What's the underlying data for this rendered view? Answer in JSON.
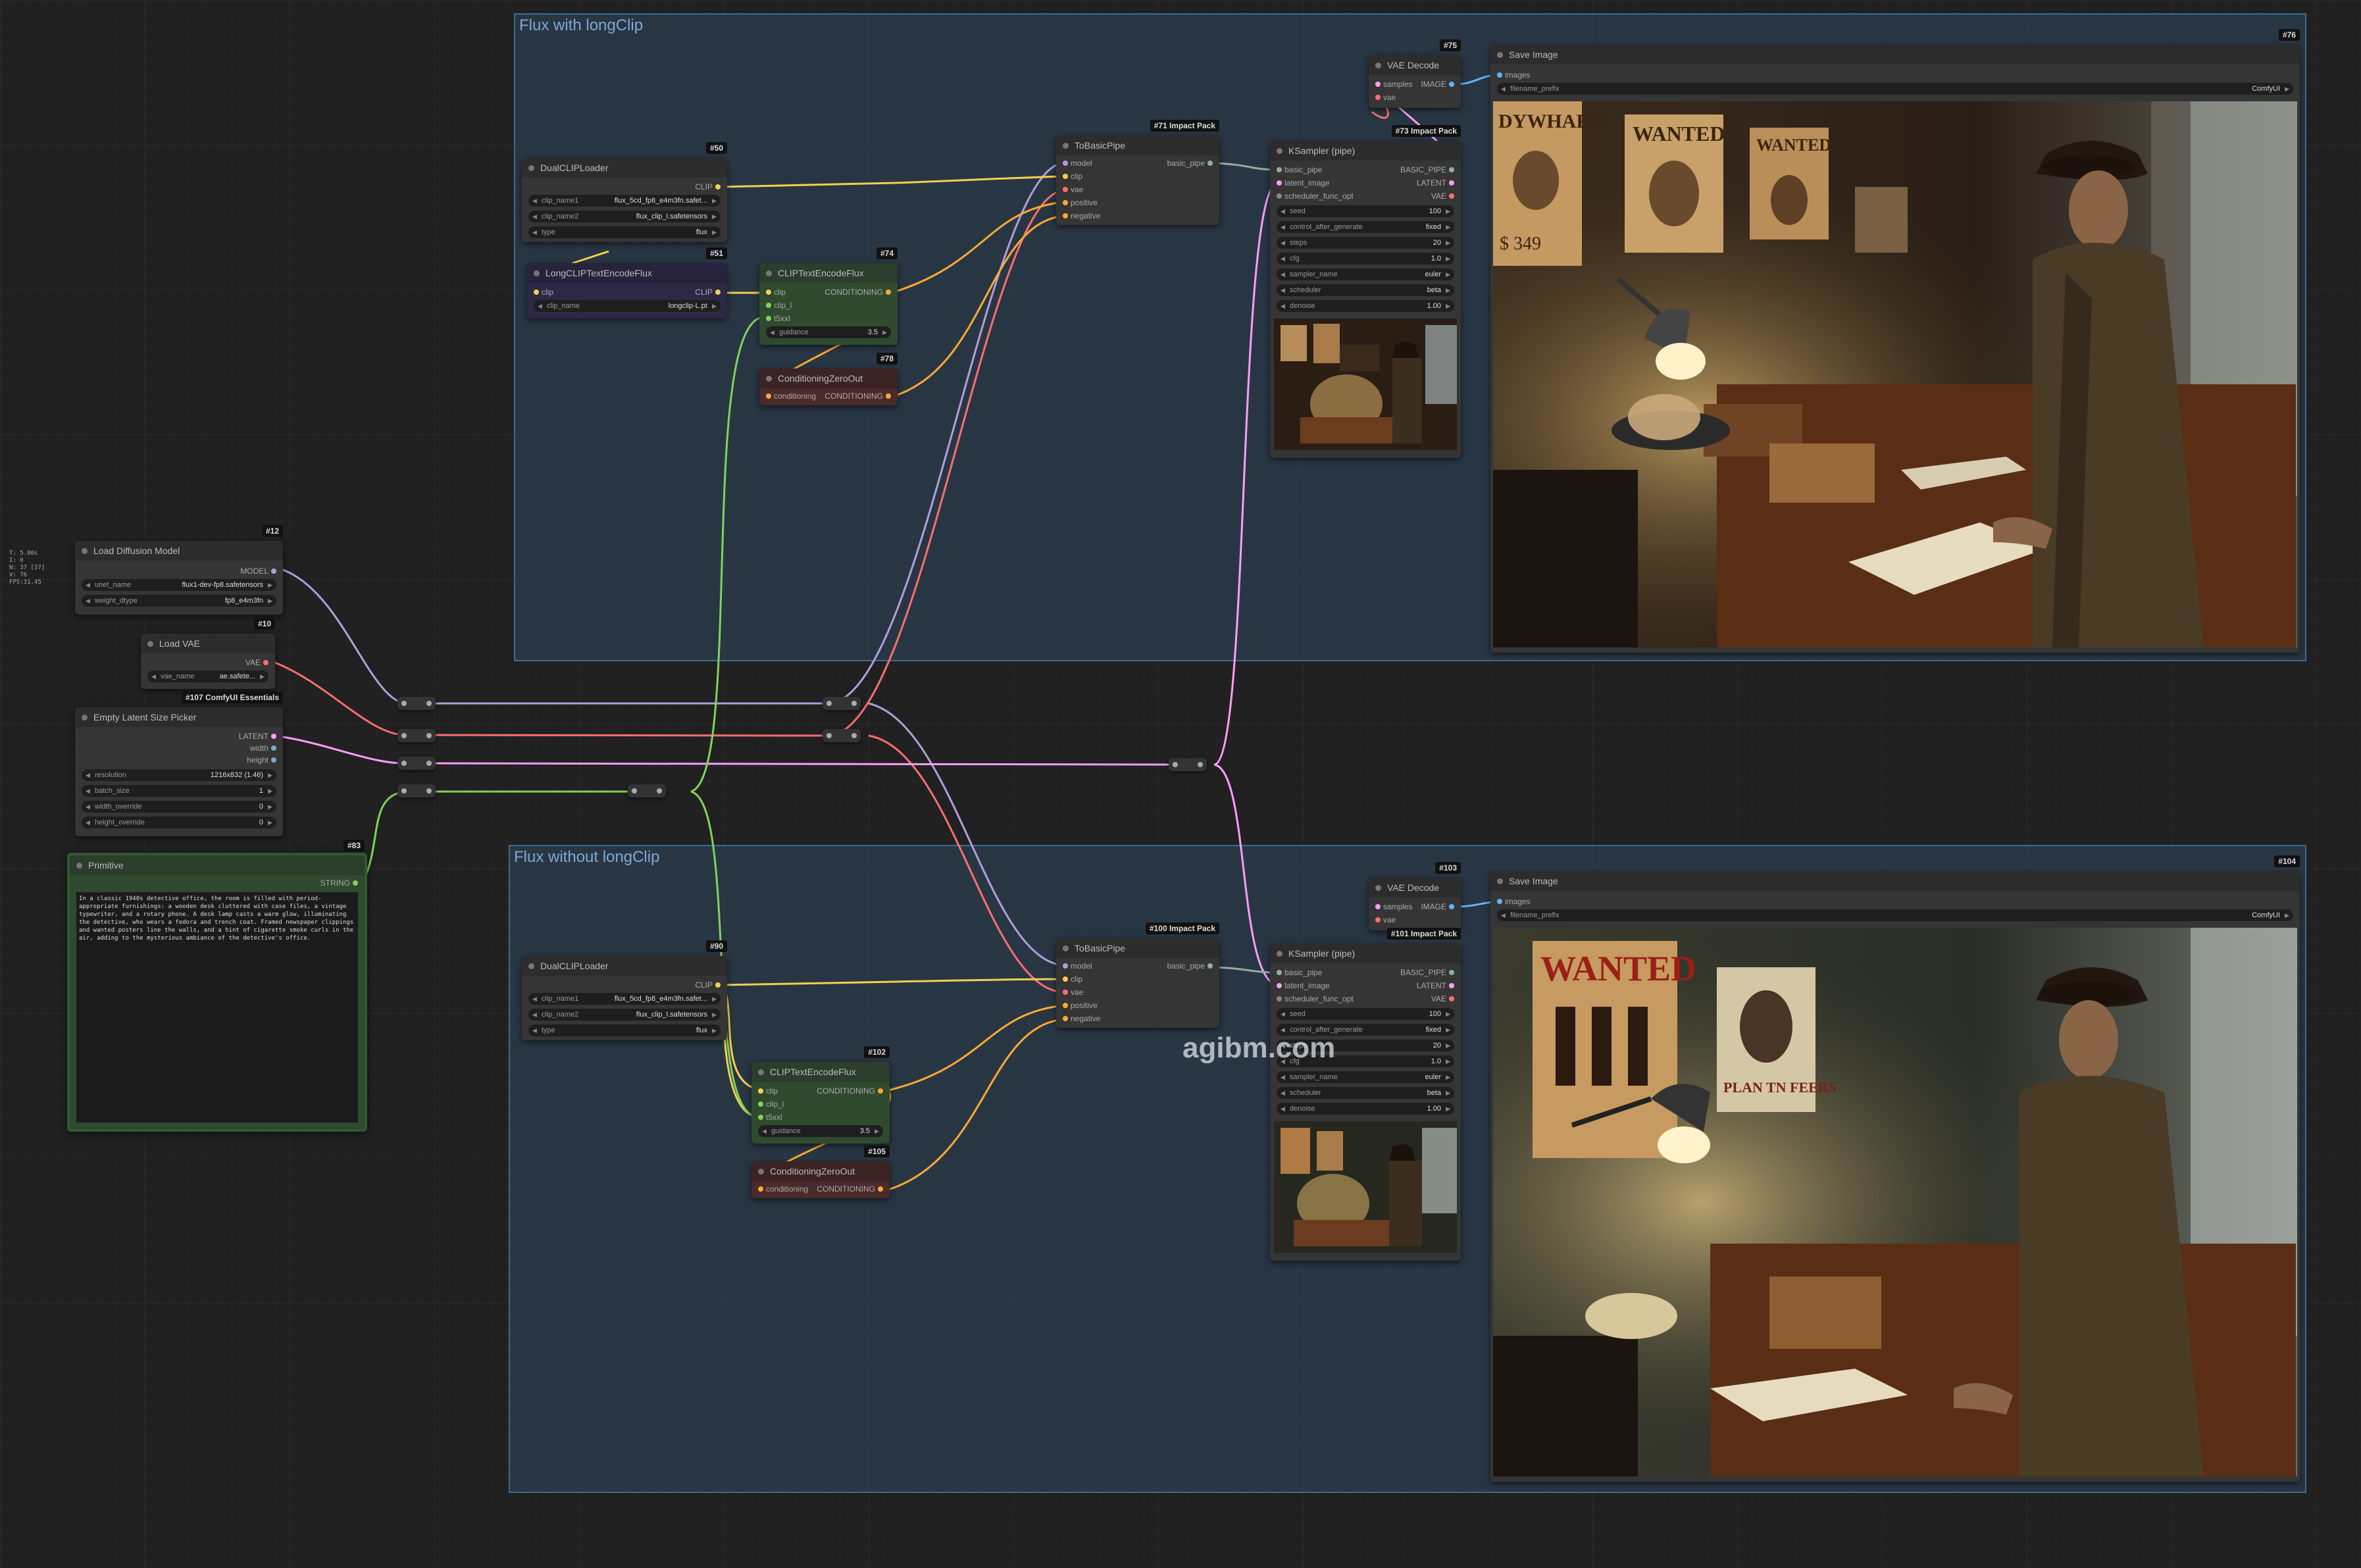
{
  "stats": [
    "T: 5.00s",
    "I: 0",
    "N: 37 [37]",
    "V: 76",
    "FPS:31.45"
  ],
  "groups": {
    "top": "Flux with longClip",
    "bottom": "Flux without longClip"
  },
  "watermark": "agibm.com",
  "colors": {
    "model": "#b39ddb",
    "clip": "#f6d04d",
    "vae": "#ff6e6e",
    "latent": "#ff9cf9",
    "cond": "#ffa931",
    "image": "#64b5f6",
    "string": "#7fd35c"
  },
  "nodes": {
    "load_diffusion": {
      "id": "#12",
      "title": "Load Diffusion Model",
      "out": "MODEL",
      "w": [
        [
          "unet_name",
          "flux1-dev-fp8.safetensors"
        ],
        [
          "weight_dtype",
          "fp8_e4m3fn"
        ]
      ]
    },
    "load_vae": {
      "id": "#10",
      "title": "Load VAE",
      "out": "VAE",
      "w": [
        [
          "vae_name",
          "ae.safete..."
        ]
      ]
    },
    "empty_latent": {
      "id": "#107 ComfyUI Essentials",
      "title": "Empty Latent Size Picker",
      "outs": [
        "LATENT",
        "width",
        "height"
      ],
      "w": [
        [
          "resolution",
          "1216x832 (1.46)"
        ],
        [
          "batch_size",
          "1"
        ],
        [
          "width_override",
          "0"
        ],
        [
          "height_override",
          "0"
        ]
      ]
    },
    "primitive": {
      "id": "#83",
      "title": "Primitive",
      "out": "STRING",
      "text": "In a classic 1940s detective office, the room is filled with period-appropriate furnishings: a wooden desk cluttered with case files, a vintage typewriter, and a rotary phone. A desk lamp casts a warm glow, illuminating the detective, who wears a fedora and trench coat. Framed newspaper clippings and wanted posters line the walls, and a hint of cigarette smoke curls in the air, adding to the mysterious ambiance of the detective's office."
    },
    "dualclip_top": {
      "id": "#50",
      "title": "DualCLIPLoader",
      "out": "CLIP",
      "w": [
        [
          "clip_name1",
          "flux_5cd_fp8_e4m3fn.safet..."
        ],
        [
          "clip_name2",
          "flux_clip_l.safetensors"
        ],
        [
          "type",
          "flux"
        ]
      ]
    },
    "longclip": {
      "id": "#51",
      "title": "LongCLIPTextEncodeFlux",
      "in": "clip",
      "out": "CLIP",
      "w": [
        [
          "clip_name",
          "longclip-L.pt"
        ]
      ]
    },
    "clipenc_top": {
      "id": "#74",
      "title": "CLIPTextEncodeFlux",
      "ins": [
        "clip",
        "clip_l",
        "t5xxl"
      ],
      "out": "CONDITIONING",
      "w": [
        [
          "guidance",
          "3.5"
        ]
      ]
    },
    "zero_top": {
      "id": "#78",
      "title": "ConditioningZeroOut",
      "in": "conditioning",
      "out": "CONDITIONING"
    },
    "tobasic_top": {
      "id": "#71 Impact Pack",
      "title": "ToBasicPipe",
      "ins": [
        "model",
        "clip",
        "vae",
        "positive",
        "negative"
      ],
      "out": "basic_pipe"
    },
    "vaedec_top": {
      "id": "#75",
      "title": "VAE Decode",
      "ins": [
        "samples",
        "vae"
      ],
      "out": "IMAGE"
    },
    "ksampler_top": {
      "id": "#73 Impact Pack",
      "title": "KSampler (pipe)",
      "ins": [
        "basic_pipe",
        "latent_image",
        "scheduler_func_opt"
      ],
      "outs": [
        "BASIC_PIPE",
        "LATENT",
        "VAE"
      ],
      "w": [
        [
          "seed",
          "100"
        ],
        [
          "control_after_generate",
          "fixed"
        ],
        [
          "steps",
          "20"
        ],
        [
          "cfg",
          "1.0"
        ],
        [
          "sampler_name",
          "euler"
        ],
        [
          "scheduler",
          "beta"
        ],
        [
          "denoise",
          "1.00"
        ]
      ]
    },
    "save_top": {
      "id": "#76",
      "title": "Save Image",
      "in": "images",
      "w": [
        [
          "filename_prefix",
          "ComfyUI"
        ]
      ]
    },
    "dualclip_bot": {
      "id": "#90",
      "title": "DualCLIPLoader",
      "out": "CLIP",
      "w": [
        [
          "clip_name1",
          "flux_5cd_fp8_e4m3fn.safet..."
        ],
        [
          "clip_name2",
          "flux_clip_l.safetensors"
        ],
        [
          "type",
          "flux"
        ]
      ]
    },
    "clipenc_bot": {
      "id": "#102",
      "title": "CLIPTextEncodeFlux",
      "ins": [
        "clip",
        "clip_l",
        "t5xxl"
      ],
      "out": "CONDITIONING",
      "w": [
        [
          "guidance",
          "3.5"
        ]
      ]
    },
    "zero_bot": {
      "id": "#105",
      "title": "ConditioningZeroOut",
      "in": "conditioning",
      "out": "CONDITIONING"
    },
    "tobasic_bot": {
      "id": "#100 Impact Pack",
      "title": "ToBasicPipe",
      "ins": [
        "model",
        "clip",
        "vae",
        "positive",
        "negative"
      ],
      "out": "basic_pipe"
    },
    "vaedec_bot": {
      "id": "#103",
      "title": "VAE Decode",
      "ins": [
        "samples",
        "vae"
      ],
      "out": "IMAGE"
    },
    "ksampler_bot": {
      "id": "#101 Impact Pack",
      "title": "KSampler (pipe)",
      "ins": [
        "basic_pipe",
        "latent_image",
        "scheduler_func_opt"
      ],
      "outs": [
        "BASIC_PIPE",
        "LATENT",
        "VAE"
      ],
      "w": [
        [
          "seed",
          "100"
        ],
        [
          "control_after_generate",
          "fixed"
        ],
        [
          "steps",
          "20"
        ],
        [
          "cfg",
          "1.0"
        ],
        [
          "sampler_name",
          "euler"
        ],
        [
          "scheduler",
          "beta"
        ],
        [
          "denoise",
          "1.00"
        ]
      ]
    },
    "save_bot": {
      "id": "#104",
      "title": "Save Image",
      "in": "images",
      "w": [
        [
          "filename_prefix",
          "ComfyUI"
        ]
      ]
    }
  },
  "poster_text": {
    "top": [
      "DYWHARD",
      "WANTED",
      "WANTED",
      "$ 349"
    ],
    "bottom": [
      "WANTED",
      "PLAN TN FEERS"
    ]
  }
}
